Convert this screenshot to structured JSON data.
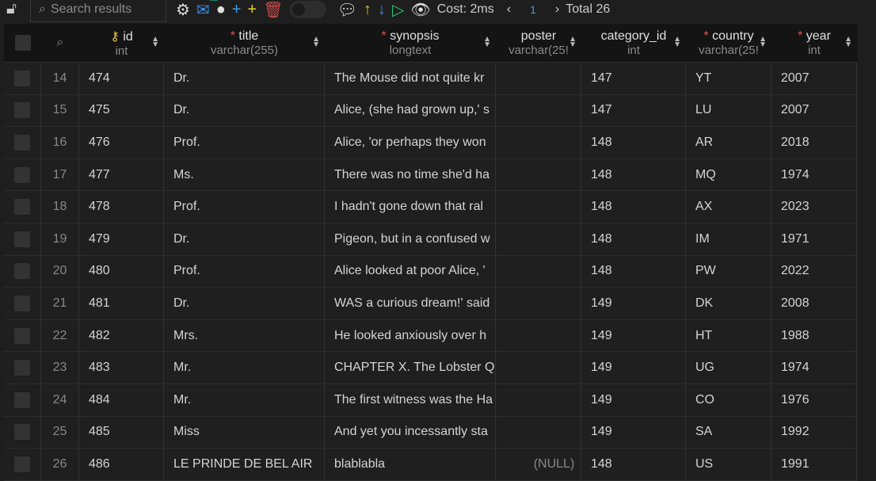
{
  "toolbar": {
    "search_placeholder": "Search results",
    "badge": "1",
    "cost": "Cost: 2ms",
    "page": "1",
    "total": "Total 26"
  },
  "columns": [
    {
      "name": "id",
      "type": "int",
      "key": true,
      "required": false
    },
    {
      "name": "title",
      "type": "varchar(255)",
      "required": true
    },
    {
      "name": "synopsis",
      "type": "longtext",
      "required": true
    },
    {
      "name": "poster",
      "type": "varchar(25!",
      "required": false
    },
    {
      "name": "category_id",
      "type": "int",
      "required": false
    },
    {
      "name": "country",
      "type": "varchar(25!",
      "required": true
    },
    {
      "name": "year",
      "type": "int",
      "required": true
    }
  ],
  "rows": [
    [
      "14",
      "474",
      "Dr.",
      "The Mouse did not quite kr",
      "",
      "147",
      "YT",
      "2007"
    ],
    [
      "15",
      "475",
      "Dr.",
      "Alice, (she had grown up,' s",
      "",
      "147",
      "LU",
      "2007"
    ],
    [
      "16",
      "476",
      "Prof.",
      "Alice, 'or perhaps they won",
      "",
      "148",
      "AR",
      "2018"
    ],
    [
      "17",
      "477",
      "Ms.",
      "There was no time she'd ha",
      "",
      "148",
      "MQ",
      "1974"
    ],
    [
      "18",
      "478",
      "Prof.",
      "I hadn't gone down that ral",
      "",
      "148",
      "AX",
      "2023"
    ],
    [
      "19",
      "479",
      "Dr.",
      "Pigeon, but in a confused w",
      "",
      "148",
      "IM",
      "1971"
    ],
    [
      "20",
      "480",
      "Prof.",
      "Alice looked at poor Alice, '",
      "",
      "148",
      "PW",
      "2022"
    ],
    [
      "21",
      "481",
      "Dr.",
      "WAS a curious dream!' said",
      "",
      "149",
      "DK",
      "2008"
    ],
    [
      "22",
      "482",
      "Mrs.",
      "He looked anxiously over h",
      "",
      "149",
      "HT",
      "1988"
    ],
    [
      "23",
      "483",
      "Mr.",
      "CHAPTER X. The Lobster Qu",
      "",
      "149",
      "UG",
      "1974"
    ],
    [
      "24",
      "484",
      "Mr.",
      "The first witness was the Ha",
      "",
      "149",
      "CO",
      "1976"
    ],
    [
      "25",
      "485",
      "Miss",
      "And yet you incessantly sta",
      "",
      "149",
      "SA",
      "1992"
    ],
    [
      "26",
      "486",
      "LE PRINDE DE BEL AIR",
      "blablabla",
      "(NULL)",
      "148",
      "US",
      "1991"
    ]
  ]
}
